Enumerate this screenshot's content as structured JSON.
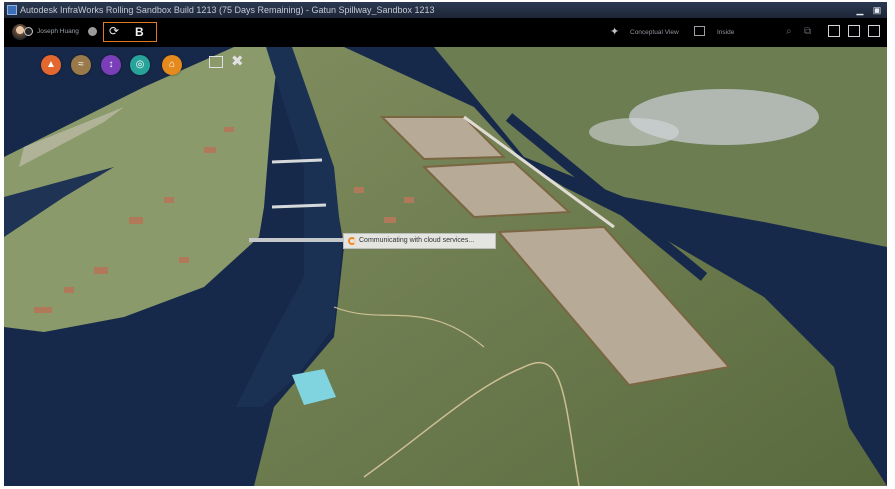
{
  "window": {
    "title": "Autodesk InfraWorks Rolling Sandbox Build 1213 (75 Days Remaining) - Gatun Spillway_Sandbox 1213",
    "minimize_glyph": "▁",
    "restore_glyph": "▣"
  },
  "toolbar": {
    "user_name": "Joseph Huang",
    "sync_glyph": "⟳",
    "b_label": "B",
    "view_label": "Conceptual View",
    "view_icon_glyph": "✦",
    "inside_label": "Inside",
    "search_glyph": "⌕",
    "link_glyph": "⧉"
  },
  "viewport": {
    "home_glyph": "⌂",
    "tools_glyph": "✖",
    "status_message": "Communicating with cloud services..."
  },
  "colors": {
    "accent": "#e07a22",
    "btn1": "#e3672f",
    "btn2": "#9a7a4a",
    "btn3": "#7a3fb8",
    "btn4": "#27a39a",
    "btn5": "#e58a1e",
    "water": "#1a2d4a"
  },
  "icons": [
    "user-avatar-icon",
    "status-dot-icon",
    "sync-icon",
    "conceptual-view-icon",
    "inside-view-icon",
    "search-icon",
    "link-icon",
    "home-icon",
    "create-tool-icon",
    "terrain-tool-icon",
    "analysis-tool-icon",
    "design-tool-icon",
    "bridge-tool-icon",
    "snapshot-icon",
    "tools-icon"
  ]
}
